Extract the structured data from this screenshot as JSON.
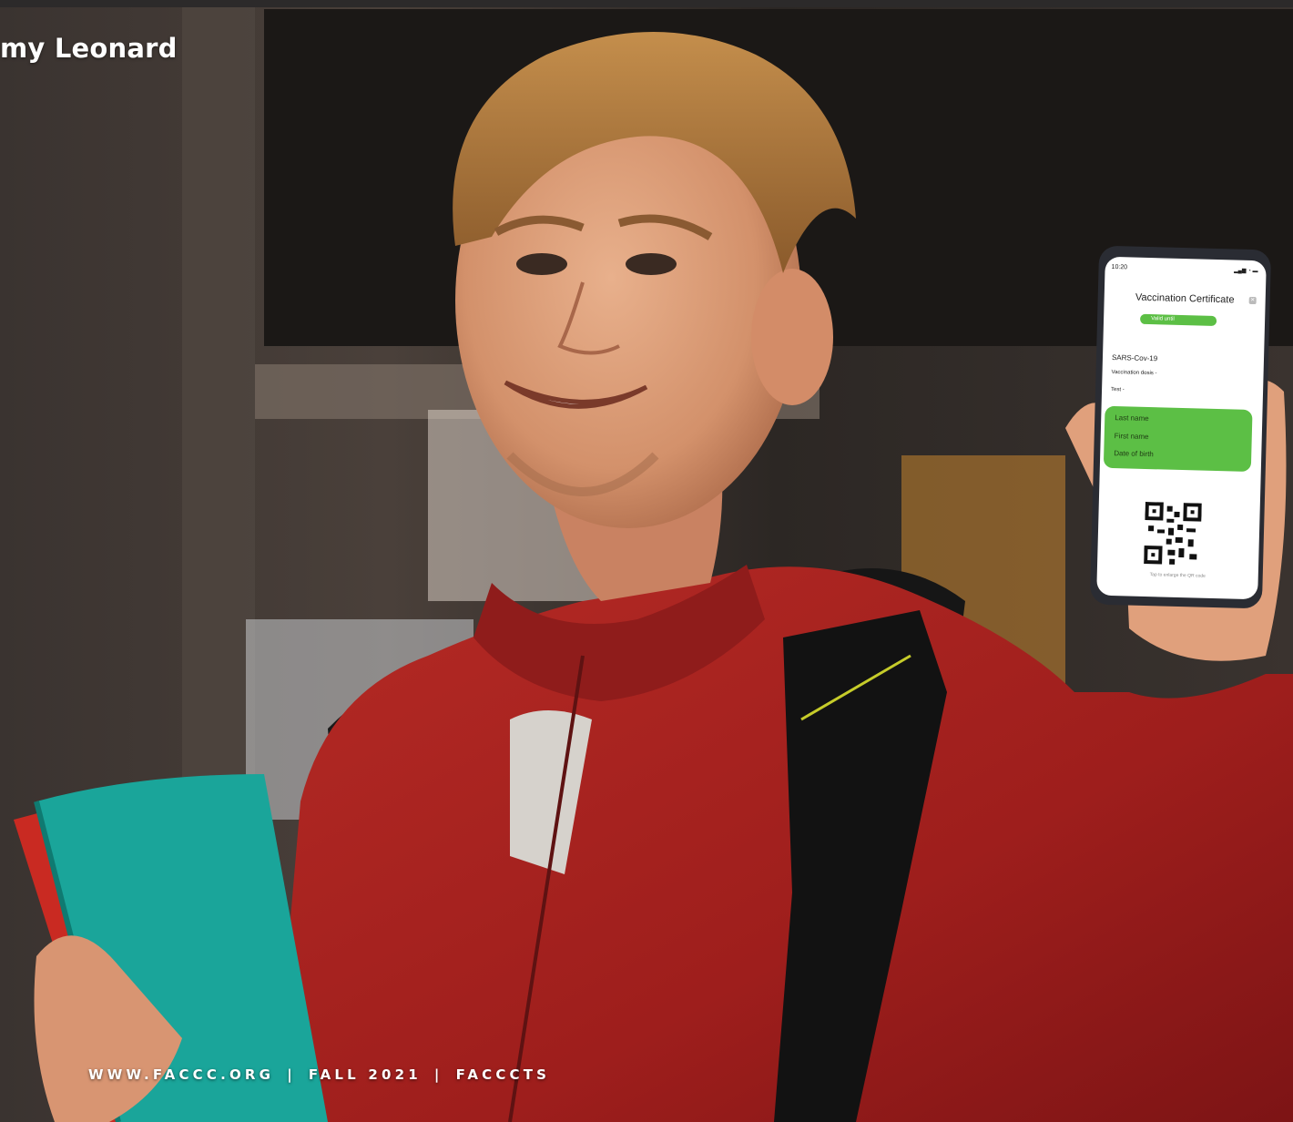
{
  "byline": "my Leonard",
  "footer": {
    "site": "WWW.FACCC.ORG",
    "issue": "FALL 2021",
    "publication": "FACCCTS",
    "separator": "|"
  },
  "phone": {
    "time": "10:20",
    "title": "Vaccination Certificate",
    "valid_label": "Valid until",
    "virus": "SARS-Cov-19",
    "vaccination": "Vaccination dosis -",
    "test": "Test -",
    "fields": [
      "Last name",
      "First name",
      "Date of birth"
    ],
    "hint": "Tap to enlarge the QR code",
    "accent": "#5cbf45"
  },
  "colors": {
    "hoodie": "#a3201f",
    "folder": "#1aa59a",
    "background": "#2a2522"
  },
  "icons": [
    "close-icon",
    "qr-code-icon",
    "signal-icon"
  ]
}
